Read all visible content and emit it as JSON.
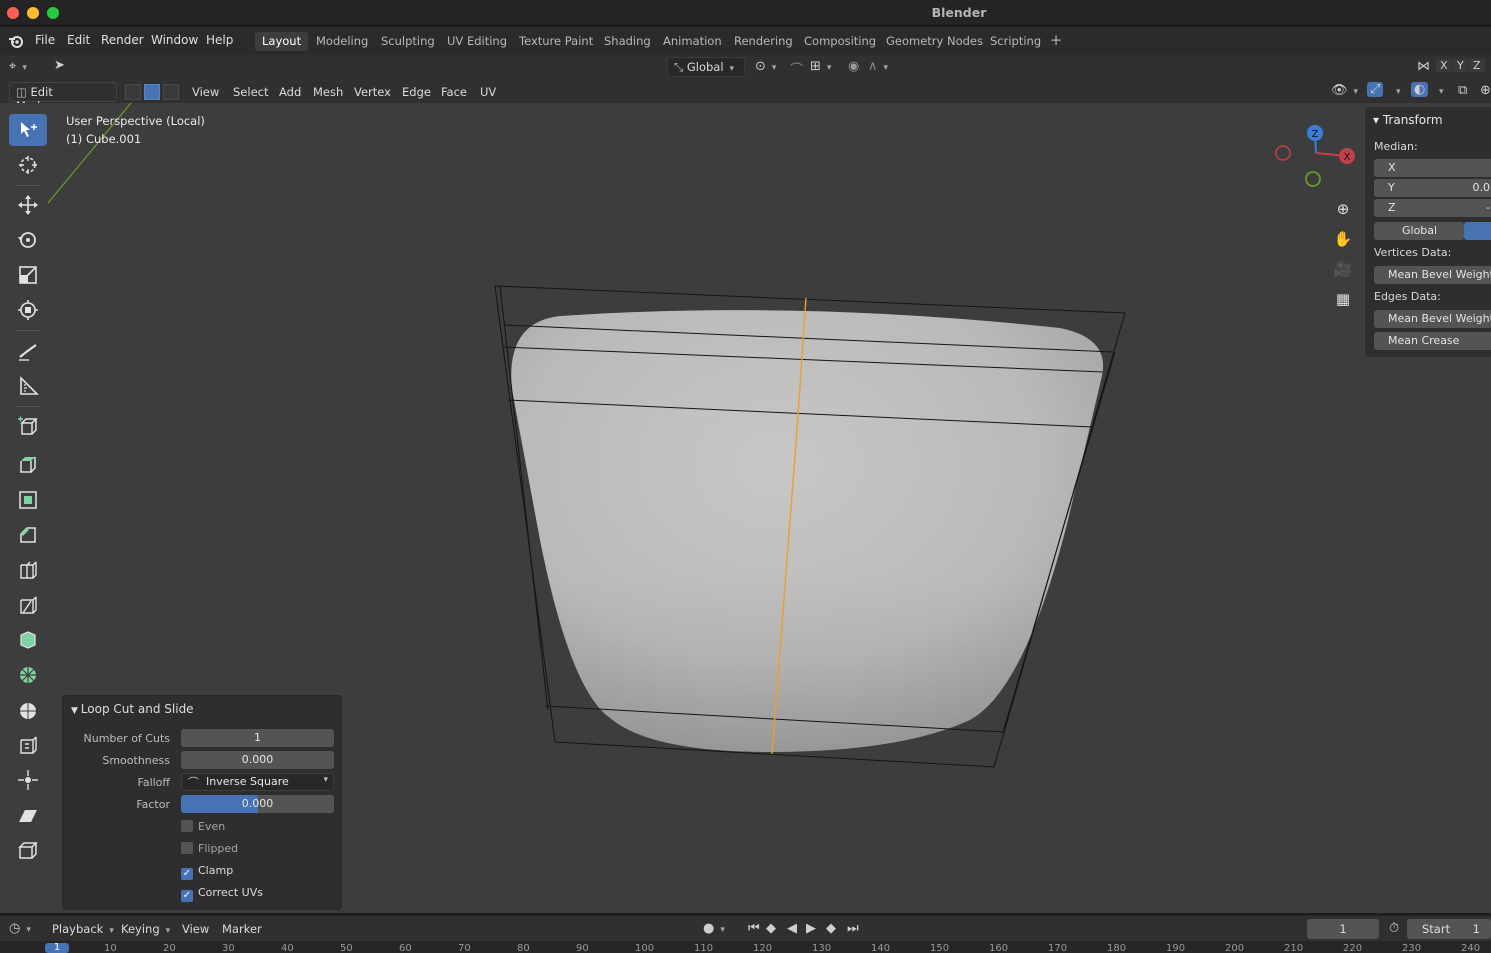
{
  "window": {
    "title": "Blender"
  },
  "menus": [
    "File",
    "Edit",
    "Render",
    "Window",
    "Help"
  ],
  "workspaces": [
    "Layout",
    "Modeling",
    "Sculpting",
    "UV Editing",
    "Texture Paint",
    "Shading",
    "Animation",
    "Rendering",
    "Compositing",
    "Geometry Nodes",
    "Scripting"
  ],
  "toolheader": {
    "orientation": "Global",
    "axes": [
      "X",
      "Y",
      "Z"
    ]
  },
  "viewport_header": {
    "mode": "Edit Mode",
    "menus": [
      "View",
      "Select",
      "Add",
      "Mesh",
      "Vertex",
      "Edge",
      "Face",
      "UV"
    ]
  },
  "viewport": {
    "perspective": "User Perspective (Local)",
    "object": "(1) Cube.001",
    "gizmo": {
      "z": "Z",
      "x": "X"
    }
  },
  "npanel": {
    "title": "Transform",
    "median_label": "Median:",
    "x_label": "X",
    "y_label": "Y",
    "y_value": "0.0",
    "z_label": "Z",
    "z_value": "-",
    "space": "Global",
    "vertices_label": "Vertices Data:",
    "vertex_bevel": "Mean Bevel Weight",
    "edges_label": "Edges Data:",
    "edge_bevel": "Mean Bevel Weight",
    "edge_crease": "Mean Crease"
  },
  "operator": {
    "title": "Loop Cut and Slide",
    "cuts_label": "Number of Cuts",
    "cuts_value": "1",
    "smooth_label": "Smoothness",
    "smooth_value": "0.000",
    "falloff_label": "Falloff",
    "falloff_value": "Inverse Square",
    "factor_label": "Factor",
    "factor_value": "0.000",
    "factor_fill": 0.5,
    "even": "Even",
    "even_checked": false,
    "flipped": "Flipped",
    "flipped_checked": false,
    "clamp": "Clamp",
    "clamp_checked": true,
    "correct_uvs": "Correct UVs",
    "correct_uvs_checked": true
  },
  "timeline": {
    "playback": "Playback",
    "keying": "Keying",
    "view": "View",
    "marker": "Marker",
    "current_frame": "1",
    "start_label": "Start",
    "start_value": "1",
    "ruler_ticks": [
      "1",
      "10",
      "20",
      "30",
      "40",
      "50",
      "60",
      "70",
      "80",
      "90",
      "100",
      "110",
      "120",
      "130",
      "140",
      "150",
      "160",
      "170",
      "180",
      "190",
      "200",
      "210",
      "220",
      "230",
      "240"
    ]
  },
  "colors": {
    "accent": "#4772b3",
    "selected_edge": "#e8a030",
    "viewport_bg": "#3d3d3d",
    "axis_x": "#c2404a",
    "axis_y": "#6a9b2a",
    "axis_z": "#3b7dd8"
  }
}
